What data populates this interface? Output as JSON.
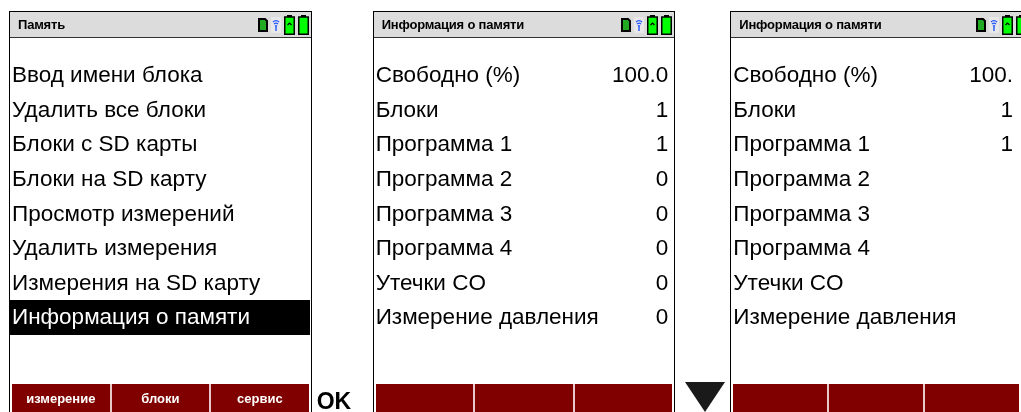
{
  "screens": [
    {
      "kind": "menu",
      "title": "Память",
      "items": [
        {
          "label": "Ввод имени блока",
          "selected": false
        },
        {
          "label": "Удалить все блоки",
          "selected": false
        },
        {
          "label": "Блоки  с SD карты",
          "selected": false
        },
        {
          "label": "Блоки  на SD карту",
          "selected": false
        },
        {
          "label": "Просмотр измерений",
          "selected": false
        },
        {
          "label": "Удалить измерения",
          "selected": false
        },
        {
          "label": "Измерения на SD карту",
          "selected": false
        },
        {
          "label": "Информация о памяти",
          "selected": true
        }
      ],
      "softkeys": [
        "измерение",
        "блоки",
        "сервис"
      ]
    },
    {
      "kind": "info",
      "title": "Информация о памяти",
      "rows": [
        {
          "label": "Свободно (%)",
          "value": "100.0"
        },
        {
          "label": "Блоки",
          "value": "1"
        },
        {
          "label": "Программа 1",
          "value": "1"
        },
        {
          "label": "Программа 2",
          "value": "0"
        },
        {
          "label": "Программа 3",
          "value": "0"
        },
        {
          "label": "Программа 4",
          "value": "0"
        },
        {
          "label": "Утечки CO",
          "value": "0"
        },
        {
          "label": "Измерение давления",
          "value": "0"
        }
      ]
    },
    {
      "kind": "info",
      "cut": true,
      "title": "Информация о памяти",
      "rows": [
        {
          "label": "Свободно (%)",
          "value": "100."
        },
        {
          "label": "Блоки",
          "value": "1"
        },
        {
          "label": "Программа 1",
          "value": "1"
        },
        {
          "label": "Программа 2"
        },
        {
          "label": "Программа 3"
        },
        {
          "label": "Программа 4"
        },
        {
          "label": "Утечки CO"
        },
        {
          "label": "Измерение давления"
        }
      ]
    }
  ],
  "ok_key": {
    "label": "OK"
  }
}
